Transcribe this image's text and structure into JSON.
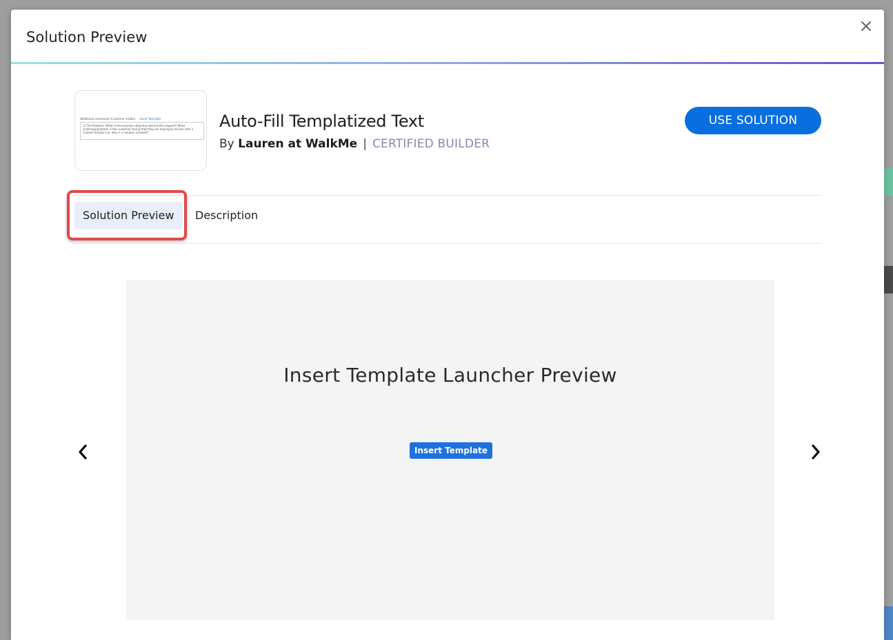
{
  "modal": {
    "title": "Solution Preview"
  },
  "solution": {
    "name": "Auto-Fill Templatized Text",
    "by_prefix": "By",
    "author": "Lauren at WalkMe",
    "separator": "|",
    "badge": "CERTIFIED BUILDER",
    "use_button_label": "USE SOLUTION"
  },
  "thumbnail": {
    "header_text": "Additional comments (Customer visible)",
    "link_text": "Insert Template",
    "body_text": "1) The Problem: What is the business objective behind this request? What challenge/problem is the customer facing that they are hoping to resolve with a Custom Solution (ie. why is a solution needed)?"
  },
  "tabs": [
    {
      "label": "Solution Preview",
      "active": true
    },
    {
      "label": "Description",
      "active": false
    }
  ],
  "preview": {
    "heading": "Insert Template Launcher Preview",
    "button_label": "Insert Template"
  },
  "icons": {
    "close": "close-icon",
    "prev": "chevron-left-icon",
    "next": "chevron-right-icon"
  },
  "colors": {
    "primary": "#0a6fde",
    "highlight": "#e24848",
    "badge": "#8c86b0"
  }
}
